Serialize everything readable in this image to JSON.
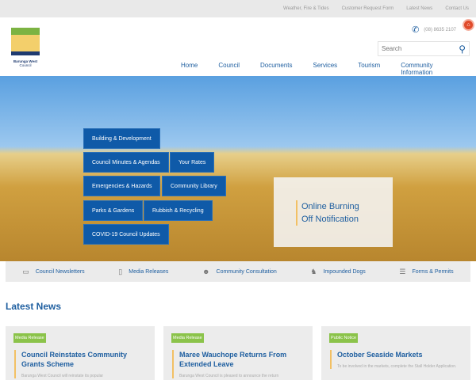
{
  "topbar": [
    "Weather, Fire & Tides",
    "Customer Request Form",
    "Latest News",
    "Contact Us"
  ],
  "logo": {
    "line1": "Barunga West",
    "line2": "Council"
  },
  "phone": "(08) 8635 2107",
  "search": {
    "placeholder": "Search"
  },
  "nav": [
    "Home",
    "Council",
    "Documents",
    "Services",
    "Tourism",
    "Community Information"
  ],
  "quick_buttons": [
    "Building & Development",
    "Council Minutes & Agendas",
    "Your Rates",
    "Emergencies & Hazards",
    "Community Library",
    "Parks & Gardens",
    "Rubbish & Recycling",
    "COVID-19 Council Updates"
  ],
  "promo": {
    "line1": "Online Burning",
    "line2": "Off Notification"
  },
  "quicklinks": [
    "Council Newsletters",
    "Media Releases",
    "Community Consultation",
    "Impounded Dogs",
    "Forms & Permits"
  ],
  "news": {
    "heading": "Latest News",
    "items": [
      {
        "tag": "Media Release",
        "title": "Council Reinstates Community Grants Scheme",
        "excerpt": "Barunga West Council will reinstate its popular"
      },
      {
        "tag": "Media Release",
        "title": "Maree Wauchope Returns From Extended Leave",
        "excerpt": "Barunga West Council is pleased to announce the return"
      },
      {
        "tag": "Public Notice",
        "title": "October Seaside Markets",
        "excerpt": "To be involved in the markets, complete the Stall Holder Application."
      }
    ]
  }
}
